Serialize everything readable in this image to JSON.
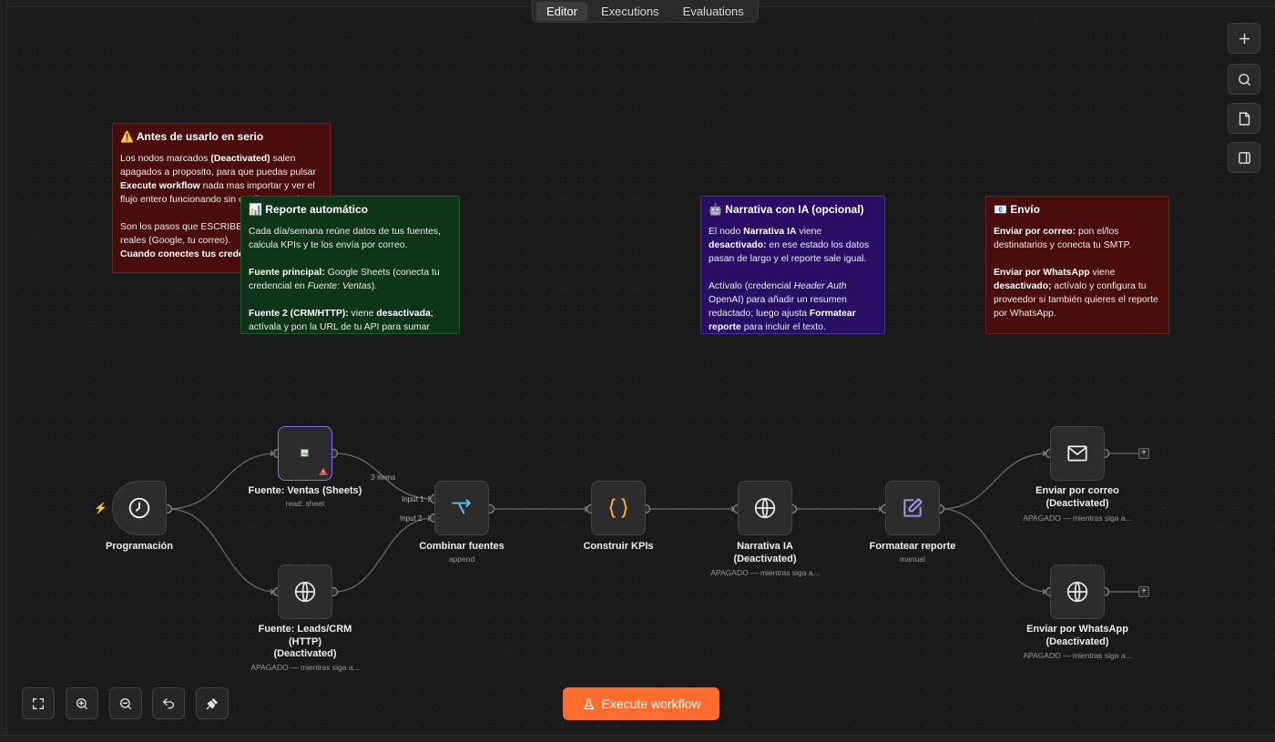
{
  "tabs": [
    "Editor",
    "Executions",
    "Evaluations"
  ],
  "active_tab": "Editor",
  "right_toolbar": [
    "plus-icon",
    "search-icon",
    "sticky-note-icon",
    "panel-icon"
  ],
  "stickies": {
    "warning": {
      "title": "⚠️ Antes de usarlo en serio",
      "line1_pre": "Los nodos marcados ",
      "line1_b": "(Deactivated)",
      "line1_post": " salen apagados a proposito, para que puedas pulsar ",
      "line1_b2": "Execute workflow",
      "line1_post2": " nada mas importar y ver el flujo entero funcionando sin configurar nada.",
      "line2": "Son los pasos que ESCRIBEN en sistemas reales (Google, tu correo).",
      "line3_b": "Cuando conectes tus credenciales"
    },
    "report": {
      "title": "📊 Reporte automático",
      "p1": "Cada día/semana reúne datos de tus fuentes, calcula KPIs y te los envía por correo.",
      "p2_b": "Fuente principal:",
      "p2": " Google Sheets (conecta tu credencial en ",
      "p2_i": "Fuente: Ventas",
      "p2_end": ").",
      "p3_b": "Fuente 2 (CRM/HTTP):",
      "p3": " viene ",
      "p3_b2": "desactivada",
      "p3_end": "; actívala y pon la URL de tu API para sumar"
    },
    "ai": {
      "title": "🤖 Narrativa con IA (opcional)",
      "p1_pre": "El nodo ",
      "p1_b": "Narrativa IA",
      "p1_mid": " viene ",
      "p1_b2": "desactivado:",
      "p1_end": " en ese estado los datos pasan de largo y el reporte sale igual.",
      "p2_pre": "Actívalo (credencial ",
      "p2_i": "Header Auth",
      "p2_mid": " OpenAI) para añadir un resumen redactado; luego ajusta ",
      "p2_b": "Formatear reporte",
      "p2_end": " para incluir el texto."
    },
    "send": {
      "title": "📧 Envío",
      "p1_b": "Enviar por correo:",
      "p1": " pon el/los destinatarios y conecta tu SMTP.",
      "p2_b": "Enviar por WhatsApp",
      "p2": " viene ",
      "p2_b2": "desactivado;",
      "p2_end": " actívalo y configura tu proveedor si también quieres el reporte por WhatsApp."
    }
  },
  "nodes": {
    "schedule": {
      "label": "Programación",
      "icon": "clock-icon"
    },
    "sheets": {
      "label": "Fuente: Ventas (Sheets)",
      "sub": "read: sheet",
      "icon": "broken-image-icon"
    },
    "leads": {
      "label": "Fuente: Leads/CRM (HTTP) (Deactivated)",
      "sub": "APAGADO — mientras siga a...",
      "icon": "globe-icon"
    },
    "merge": {
      "label": "Combinar fuentes",
      "sub": "append",
      "input1": "Input 1",
      "input2": "Input 2",
      "items": "3 items"
    },
    "kpis": {
      "label": "Construir KPIs",
      "icon": "braces-icon"
    },
    "ai": {
      "label": "Narrativa IA (Deactivated)",
      "sub": "APAGADO — mientras siga a...",
      "icon": "globe-icon"
    },
    "format": {
      "label": "Formatear reporte",
      "sub": "manual",
      "icon": "edit-icon"
    },
    "email": {
      "label": "Enviar por correo (Deactivated)",
      "sub": "APAGADO — mientras siga a...",
      "icon": "mail-icon"
    },
    "whatsapp": {
      "label": "Enviar por WhatsApp (Deactivated)",
      "sub": "APAGADO — mientras siga a...",
      "icon": "globe-icon"
    }
  },
  "execute_label": "Execute workflow",
  "colors": {
    "accent": "#ff6d2e",
    "selected": "#8a6cf2",
    "merge_icon": "#5ec8f0",
    "braces_icon": "#f5b13a",
    "edit_icon": "#a895f7"
  }
}
